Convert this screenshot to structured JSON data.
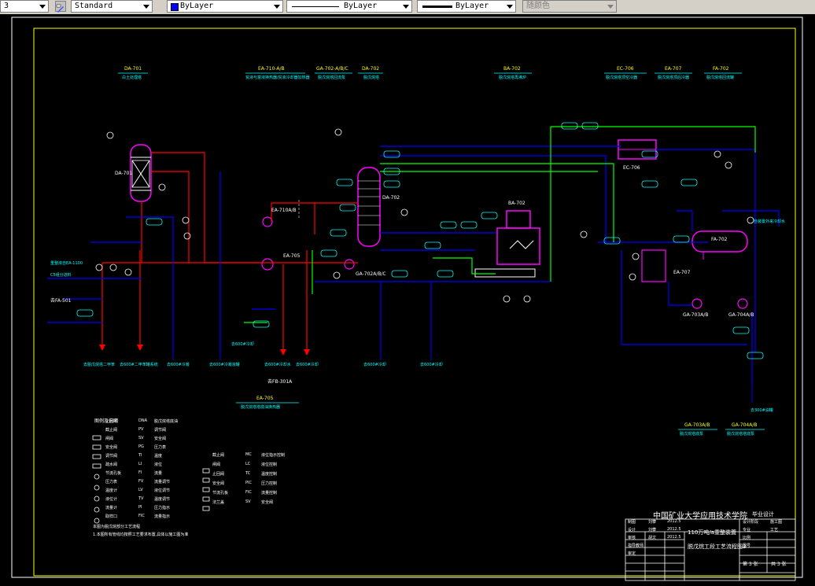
{
  "toolbar": {
    "layer_value": "3",
    "textstyle_value": "Standard",
    "color_value": "ByLayer",
    "linetype_value": "ByLayer",
    "lineweight_value": "ByLayer",
    "plotstyle_value": "随颜色"
  },
  "colors": {
    "frame": "#ffffff",
    "border": "#ffff00",
    "pipe_red": "#ff0000",
    "pipe_blue": "#0000ff",
    "pipe_green": "#00ff00",
    "text_cyan": "#00ffff",
    "text_yellow": "#ffff00",
    "equip_magenta": "#ff00ff"
  },
  "equipment_headers": [
    {
      "tag": "DA-701",
      "desc": "白土处理塔"
    },
    {
      "tag": "EA-710-A/B",
      "desc": "贫液与富液换热器/贫液冷却器加热器"
    },
    {
      "tag": "GA-702-A/B/C",
      "desc": "脱戊烷塔回流泵"
    },
    {
      "tag": "DA-702",
      "desc": "脱戊烷塔"
    },
    {
      "tag": "BA-702",
      "desc": "脱戊烷塔再沸炉"
    },
    {
      "tag": "EC-706",
      "desc": "脱戊烷塔顶空冷器"
    },
    {
      "tag": "EA-707",
      "desc": "脱戊烷塔顶后冷器"
    },
    {
      "tag": "FA-702",
      "desc": "脱戊烷塔回流罐"
    }
  ],
  "equipment_tags": {
    "da701": "DA-701",
    "ea710": "EA-710A/B",
    "ea705": "EA-705",
    "da702": "DA-702",
    "ba702": "BA-702",
    "ec706": "EC-706",
    "fa702": "FA-702",
    "ea707": "EA-707",
    "ga702": "GA-702A/B/C",
    "ga703": "GA-703A/B",
    "ga704": "GA-704A/B",
    "fa501": "去FA-501",
    "fb301": "去FB-301A"
  },
  "line_labels": {
    "feed": "重整液自EA-1100",
    "feed2": "C5组分进料",
    "to_fa501": "去FA-501",
    "out1": "去脱戊烷塔二甲苯",
    "out2": "去600#二甲苯罐系统",
    "out3": "去600#冷凝",
    "out4": "去600#冷凝液罐",
    "out5": "去600#冷却水",
    "out6": "去600#冷却",
    "out7": "去600#冷却",
    "out8": "去600#冷却",
    "out9": "去600#冷却",
    "out10": "去300#油罐",
    "to_ea706": "自装置外来冷却水"
  },
  "bottom_headers": [
    {
      "tag": "EA-705",
      "desc": "脱戊烷塔塔底油换热器"
    },
    {
      "tag": "GA-703A/B",
      "desc": "脱戊烷塔底泵"
    },
    {
      "tag": "GA-704A/B",
      "desc": "脱戊烷塔塔底泵"
    }
  ],
  "legend": {
    "title": "图例及说明",
    "left_items": [
      "止回阀",
      "截止阀",
      "闸阀",
      "安全阀",
      "调节阀",
      "疏水阀",
      "节流孔板",
      "压力表",
      "温度计",
      "液位计",
      "流量计",
      "取样口"
    ],
    "left_codes": [
      "DNA",
      "PV",
      "SV",
      "PG",
      "TI",
      "LI",
      "FI",
      "FV",
      "LV",
      "TV",
      "PI",
      "FIC"
    ],
    "left_descs": [
      "脱戊烷塔底油",
      "调节阀",
      "安全阀",
      "压力表",
      "温度",
      "液位",
      "流量",
      "流量调节",
      "液位调节",
      "温度调节",
      "压力指示",
      "流量指示"
    ],
    "mid_items": [
      "截止阀",
      "闸阀",
      "止回阀",
      "安全阀",
      "节流孔板",
      "法兰盖"
    ],
    "mid_codes": [
      "MC",
      "LC",
      "TC",
      "PIC",
      "FIC",
      "SV"
    ],
    "mid_descs": [
      "液位指示控制",
      "液位控制",
      "温度控制",
      "压力控制",
      "流量控制",
      "安全阀"
    ],
    "notes": [
      "本图为脱戊烷部分工艺流程",
      "1.本图所有管线均按照工艺要求布置,具体以施工图为准"
    ]
  },
  "titleblock": {
    "school": "中国矿业大学应用技术学院",
    "type": "毕业设计",
    "project_line1": "110万吨/a重整装置",
    "project_line2": "脱戊烷工段工艺流程图3",
    "rows": [
      {
        "role": "制图",
        "name": "刘攀",
        "date": "2012.5"
      },
      {
        "role": "设计",
        "name": "刘攀",
        "date": "2012.5"
      },
      {
        "role": "审核",
        "name": "胡文",
        "date": "2012.5"
      },
      {
        "role": "指导教师",
        "name": "",
        "date": ""
      },
      {
        "role": "审定",
        "name": "",
        "date": ""
      }
    ],
    "right_cells": [
      "设计阶段",
      "施工图",
      "专业",
      "工艺",
      "比例",
      "",
      "图号",
      ""
    ],
    "sheet": "第 3 张",
    "total": "共 3 张"
  }
}
